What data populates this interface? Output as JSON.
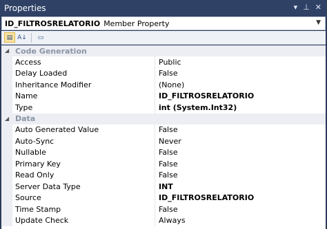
{
  "window": {
    "title": "Properties"
  },
  "titlebar_icons": [
    "dropdown-arrow-icon",
    "pin-icon",
    "close-icon"
  ],
  "object": {
    "name": "ID_FILTROSRELATORIO",
    "type": "Member Property"
  },
  "toolbar": {
    "buttons": [
      "categorized-icon",
      "alphabetical-icon",
      "property-pages-icon"
    ]
  },
  "categories": [
    {
      "label": "Code Generation",
      "properties": [
        {
          "name": "Access",
          "value": "Public",
          "bold": false
        },
        {
          "name": "Delay Loaded",
          "value": "False",
          "bold": false
        },
        {
          "name": "Inheritance Modifier",
          "value": "(None)",
          "bold": false
        },
        {
          "name": "Name",
          "value": "ID_FILTROSRELATORIO",
          "bold": true
        },
        {
          "name": "Type",
          "value": "int (System.Int32)",
          "bold": true
        }
      ]
    },
    {
      "label": "Data",
      "properties": [
        {
          "name": "Auto Generated Value",
          "value": "False",
          "bold": false
        },
        {
          "name": "Auto-Sync",
          "value": "Never",
          "bold": false
        },
        {
          "name": "Nullable",
          "value": "False",
          "bold": false
        },
        {
          "name": "Primary Key",
          "value": "False",
          "bold": false
        },
        {
          "name": "Read Only",
          "value": "False",
          "bold": false
        },
        {
          "name": "Server Data Type",
          "value": "INT",
          "bold": true
        },
        {
          "name": "Source",
          "value": "ID_FILTROSRELATORIO",
          "bold": true
        },
        {
          "name": "Time Stamp",
          "value": "False",
          "bold": false
        },
        {
          "name": "Update Check",
          "value": "Always",
          "bold": false
        }
      ]
    }
  ]
}
